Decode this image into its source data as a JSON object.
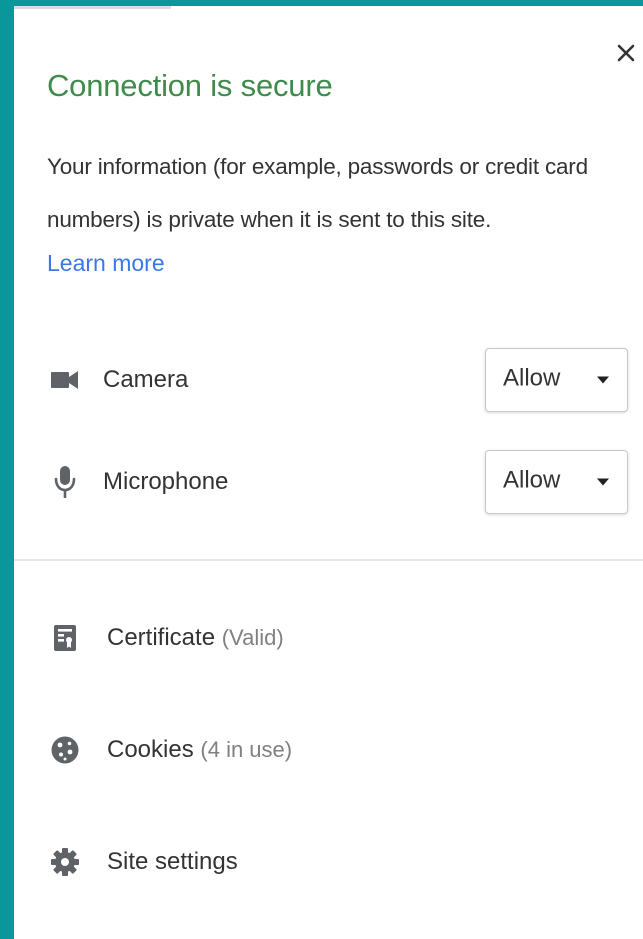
{
  "header": {
    "title": "Connection is secure",
    "description": "Your information (for example, passwords or credit card numbers) is private when it is sent to this site.",
    "learn_more": "Learn more",
    "close_icon": "close-icon"
  },
  "permissions": [
    {
      "label": "Camera",
      "value": "Allow",
      "icon": "camera-icon"
    },
    {
      "label": "Microphone",
      "value": "Allow",
      "icon": "microphone-icon"
    }
  ],
  "info": [
    {
      "label": "Certificate",
      "detail": "(Valid)",
      "icon": "certificate-icon"
    },
    {
      "label": "Cookies",
      "detail": "(4 in use)",
      "icon": "cookie-icon"
    },
    {
      "label": "Site settings",
      "icon": "gear-icon"
    }
  ],
  "colors": {
    "background": "#0a979b",
    "title": "#3f8b4c",
    "link": "#3b78e7",
    "icon": "#5f6368"
  }
}
